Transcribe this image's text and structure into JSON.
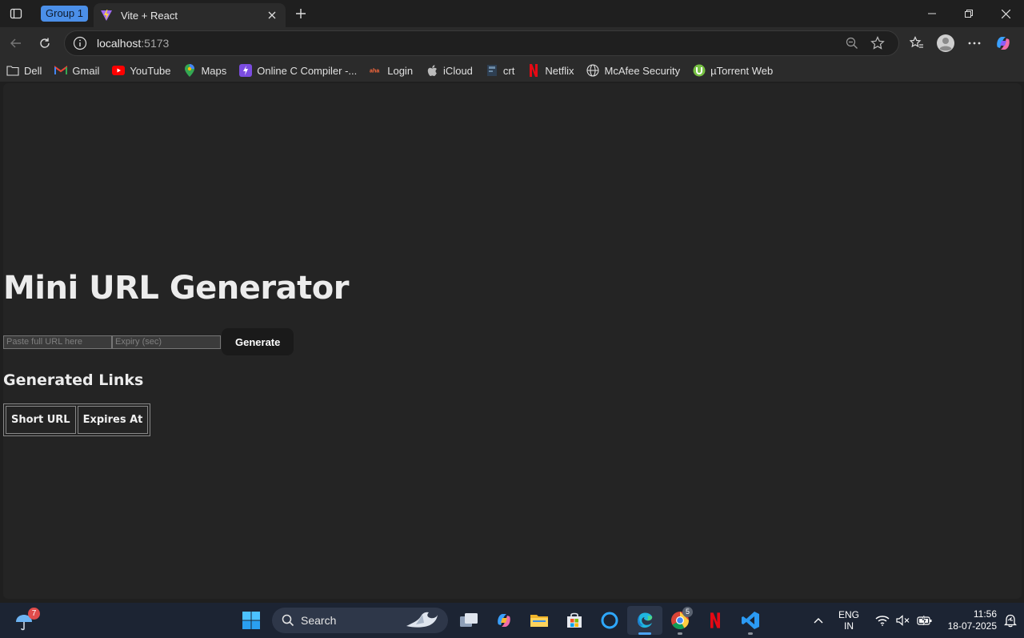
{
  "browser": {
    "group_label": "Group 1",
    "tab_title": "Vite + React",
    "url_host": "localhost",
    "url_port": ":5173"
  },
  "bookmarks": [
    {
      "label": "Dell",
      "icon": "folder-icon"
    },
    {
      "label": "Gmail",
      "icon": "gmail-icon"
    },
    {
      "label": "YouTube",
      "icon": "youtube-icon"
    },
    {
      "label": "Maps",
      "icon": "maps-icon"
    },
    {
      "label": "Online C Compiler -...",
      "icon": "compiler-icon"
    },
    {
      "label": "Login",
      "icon": "login-icon"
    },
    {
      "label": "iCloud",
      "icon": "apple-icon"
    },
    {
      "label": "crt",
      "icon": "crt-icon"
    },
    {
      "label": "Netflix",
      "icon": "netflix-icon"
    },
    {
      "label": "McAfee Security",
      "icon": "globe-icon"
    },
    {
      "label": "µTorrent Web",
      "icon": "utorrent-icon"
    }
  ],
  "page": {
    "title": "Mini URL Generator",
    "url_placeholder": "Paste full URL here",
    "expiry_placeholder": "Expiry (sec)",
    "generate_label": "Generate",
    "links_heading": "Generated Links",
    "table_headers": [
      "Short URL",
      "Expires At"
    ]
  },
  "taskbar": {
    "weather_badge": "7",
    "search_label": "Search",
    "chrome_badge": "5",
    "lang_line1": "ENG",
    "lang_line2": "IN",
    "time": "11:56",
    "date": "18-07-2025"
  },
  "colors": {
    "page_bg": "#242424",
    "browser_bg": "#2b2b2b",
    "accent": "#4b8fe8",
    "taskbar_bg": "#1c2433"
  }
}
